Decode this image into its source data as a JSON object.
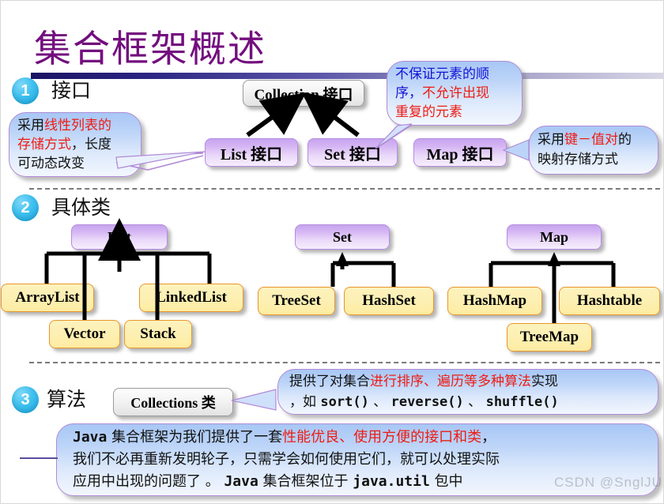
{
  "slide": {
    "title": "集合框架概述",
    "watermark": "CSDN @SnglJUN",
    "colors": {
      "title": "#730e7e",
      "badge": "#17a8e0",
      "accent_red": "#ee1c14",
      "accent_blue": "#1414d8",
      "box_purple": "#c7a4ef",
      "box_yellow": "#fdeca2",
      "box_grey": "#f3f3f3"
    }
  },
  "sections": [
    {
      "number": "1",
      "label": "接口"
    },
    {
      "number": "2",
      "label": "具体类"
    },
    {
      "number": "3",
      "label": "算法"
    }
  ],
  "interfaces": {
    "root": "Collection 接口",
    "children": [
      {
        "name": "List 接口"
      },
      {
        "name": "Set 接口"
      },
      {
        "name": "Map 接口"
      }
    ],
    "callouts": {
      "list": {
        "lines": [
          [
            {
              "t": "采用",
              "c": "black"
            },
            {
              "t": "线性列表的",
              "c": "red"
            }
          ],
          [
            {
              "t": "存储方式",
              "c": "red"
            },
            {
              "t": "，长度",
              "c": "black"
            }
          ],
          [
            {
              "t": "可动态改变",
              "c": "black"
            }
          ]
        ]
      },
      "set": {
        "lines": [
          [
            {
              "t": "不保证元素的顺",
              "c": "blue"
            }
          ],
          [
            {
              "t": "序，",
              "c": "blue"
            },
            {
              "t": "不允许出现",
              "c": "red"
            }
          ],
          [
            {
              "t": "重复的元素",
              "c": "red"
            }
          ]
        ]
      },
      "map": {
        "lines": [
          [
            {
              "t": "采用",
              "c": "black"
            },
            {
              "t": "键－值对",
              "c": "red"
            },
            {
              "t": "的",
              "c": "black"
            }
          ],
          [
            {
              "t": "映射存储方式",
              "c": "black"
            }
          ]
        ]
      }
    }
  },
  "classes": {
    "list": {
      "parent": "List",
      "children": [
        "ArrayList",
        "Vector",
        "Stack",
        "LinkedList"
      ]
    },
    "set": {
      "parent": "Set",
      "children": [
        "TreeSet",
        "HashSet"
      ]
    },
    "map": {
      "parent": "Map",
      "children": [
        "HashMap",
        "TreeMap",
        "Hashtable"
      ]
    }
  },
  "algorithms": {
    "class_box": "Collections 类",
    "callout": {
      "lines": [
        [
          {
            "t": "提供了对集合",
            "c": "black"
          },
          {
            "t": "进行排序、遍历等多种算法",
            "c": "red"
          },
          {
            "t": "实现",
            "c": "black"
          }
        ],
        [
          {
            "t": "，如 ",
            "c": "black"
          },
          {
            "t": "sort()",
            "c": "mono"
          },
          {
            "t": "、 ",
            "c": "black"
          },
          {
            "t": "reverse()",
            "c": "mono"
          },
          {
            "t": "、 ",
            "c": "black"
          },
          {
            "t": "shuffle()",
            "c": "mono"
          }
        ]
      ]
    },
    "summary": {
      "lines": [
        [
          {
            "t": "Java",
            "c": "mono"
          },
          {
            "t": " 集合框架为我们提供了一套",
            "c": "black"
          },
          {
            "t": "性能优良、使用方便的接口和类",
            "c": "red"
          },
          {
            "t": "，",
            "c": "black"
          }
        ],
        [
          {
            "t": "我们不必再重新发明轮子，只需学会如何使用它们，就可以处理实际",
            "c": "black"
          }
        ],
        [
          {
            "t": "应用中出现的问题了 。 ",
            "c": "black"
          },
          {
            "t": "Java",
            "c": "mono"
          },
          {
            "t": " 集合框架位于 ",
            "c": "black"
          },
          {
            "t": "java.util",
            "c": "mono"
          },
          {
            "t": " 包中",
            "c": "black"
          }
        ]
      ]
    }
  }
}
